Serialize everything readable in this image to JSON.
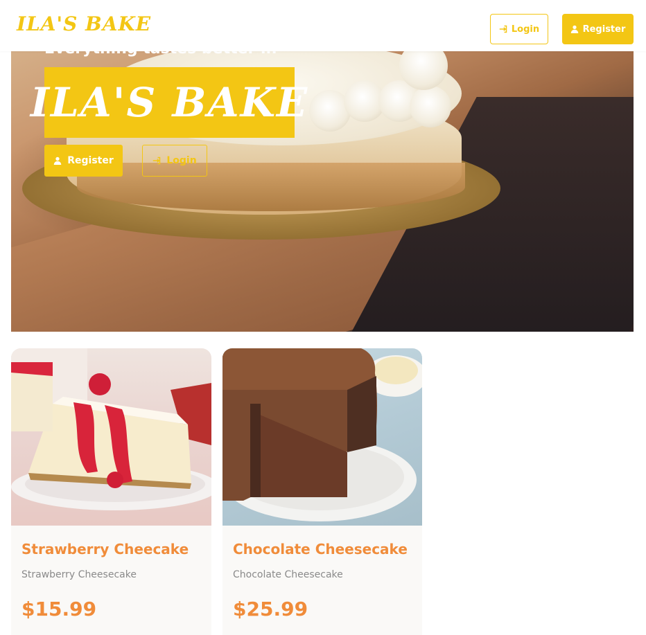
{
  "navbar": {
    "brand": "ILA'S BAKE",
    "login_label": "Login",
    "register_label": "Register"
  },
  "hero": {
    "tagline": "Everything tastes better in",
    "title": "ILA'S BAKE",
    "register_label": "Register",
    "login_label": "Login"
  },
  "products": [
    {
      "name": "Strawberry Cheecake",
      "description": "Strawberry Cheesecake",
      "price": "$15.99"
    },
    {
      "name": "Chocolate Cheesecake",
      "description": "Chocolate Cheesecake",
      "price": "$25.99"
    }
  ],
  "colors": {
    "accent": "#f3c614",
    "price": "#f08c3a",
    "muted_text": "#8a8a8a"
  },
  "icons": {
    "login": "sign-in-icon",
    "register": "user-icon"
  }
}
